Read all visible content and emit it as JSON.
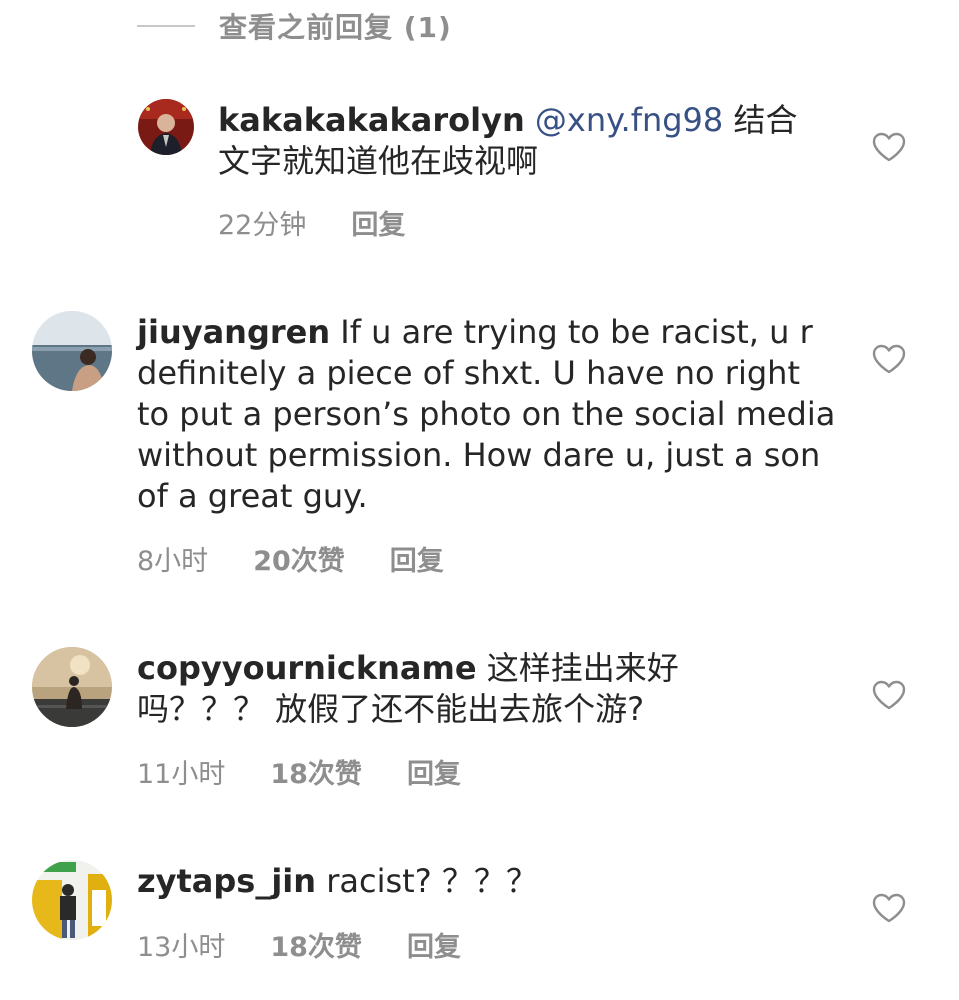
{
  "view_previous": {
    "label": "查看之前回复 (1)"
  },
  "comments": [
    {
      "username": "kakakakakarolyn",
      "mention": "@xny.fng98",
      "text_line1": " 结合",
      "text_rest": "文字就知道他在歧视啊",
      "time": "22分钟",
      "likes": "",
      "reply": "回复"
    },
    {
      "username": "jiuyangren",
      "text": " If u are trying to be racist, u r definitely a piece of shxt. U have no right to put a person’s photo on the social media without permission. How dare u, just a son of a great guy.",
      "time": "8小时",
      "likes": "20次赞",
      "reply": "回复"
    },
    {
      "username": "copyyournickname",
      "text": " 这样挂出来好吗？？？ 放假了还不能出去旅个游?",
      "time": "11小时",
      "likes": "18次赞",
      "reply": "回复"
    },
    {
      "username": "zytaps_jin",
      "text": " racist? ？？？",
      "time": "13小时",
      "likes": "18次赞",
      "reply": "回复"
    }
  ],
  "icons": {
    "like": "heart-outline-icon"
  },
  "colors": {
    "text": "#262626",
    "secondary": "#8e8e8e",
    "mention": "#385185"
  }
}
